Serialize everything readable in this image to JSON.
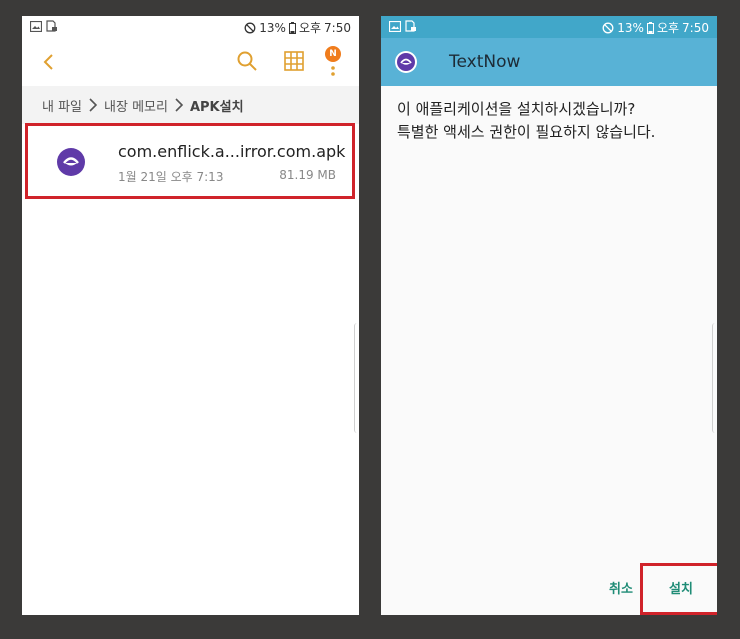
{
  "status_bar": {
    "left_icons": [
      "image-icon",
      "file-lock-icon"
    ],
    "right": {
      "mute_icon": "do-not-disturb-icon",
      "battery_percent": "13%",
      "battery_icon": "battery-icon",
      "ampm": "오후",
      "time": "7:50"
    }
  },
  "file_manager": {
    "toolbar": {
      "back_icon": "chevron-left-icon",
      "search_icon": "search-icon",
      "grid_icon": "grid-view-icon",
      "more_icon": "more-vert-icon",
      "badge": "N"
    },
    "breadcrumb": [
      "내 파일",
      "내장 메모리",
      "APK설치"
    ],
    "files": [
      {
        "icon": "textnow-app-icon",
        "name": "com.enflick.a...irror.com.apk",
        "date": "1월 21일 오후 7:13",
        "size": "81.19 MB"
      }
    ]
  },
  "installer": {
    "app_icon": "textnow-app-icon",
    "app_name": "TextNow",
    "question": "이 애플리케이션을 설치하시겠습니까?",
    "details": "특별한 액세스 권한이 필요하지 않습니다.",
    "cancel_label": "취소",
    "install_label": "설치"
  },
  "colors": {
    "accent_orange": "#e0a030",
    "badge_orange": "#f07c1c",
    "app_purple": "#5f3aa8",
    "header_blue": "#58b2d6",
    "button_teal": "#1f8c76",
    "highlight_red": "#d0232a"
  }
}
